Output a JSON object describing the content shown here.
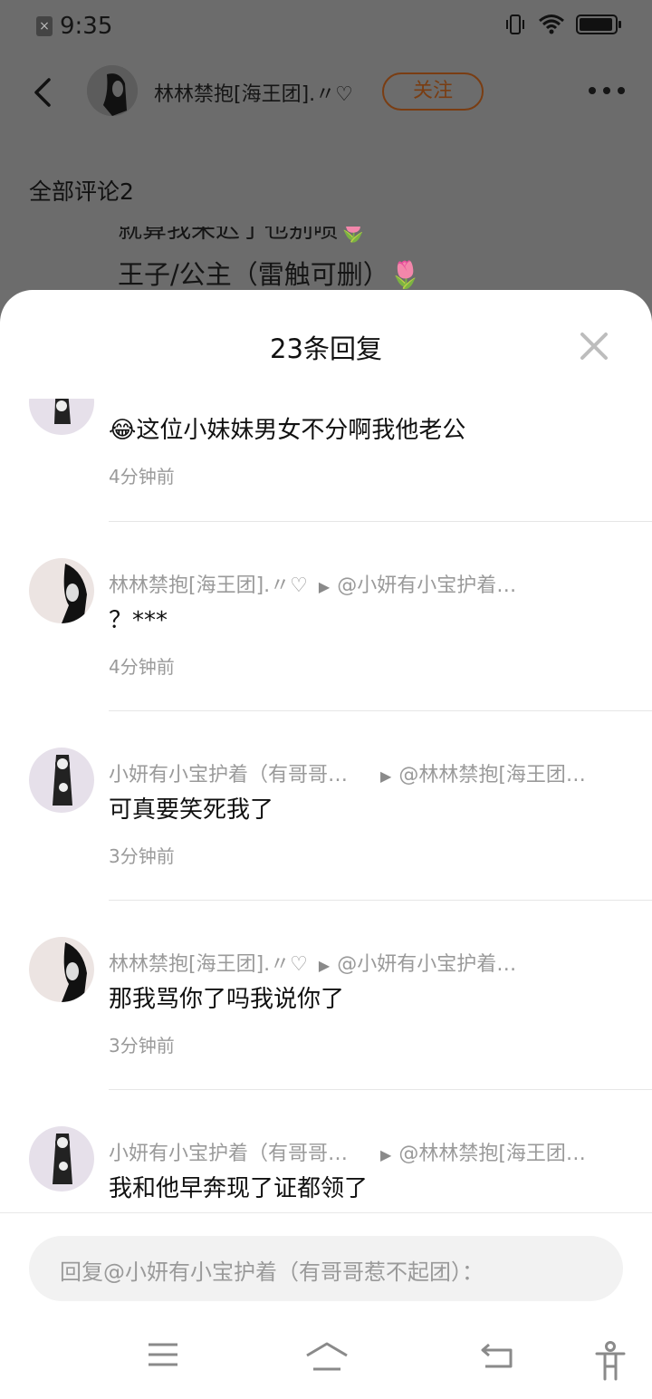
{
  "status_bar": {
    "time": "9:35",
    "notification_icon": "close-box-icon",
    "icons": [
      "vibrate-icon",
      "wifi-icon",
      "battery-icon"
    ]
  },
  "header": {
    "username": "林林禁抱[海王团].〃♡",
    "follow_label": "关注",
    "more_icon": "more-dots-icon",
    "back_icon": "back-arrow-icon"
  },
  "background": {
    "comments_title": "全部评论2",
    "peek_line_1": "就算我来迟了也别喷🌷",
    "peek_line_2": "王子/公主（雷触可删）🌷"
  },
  "sheet": {
    "title": "23条回复",
    "close_icon": "close-x-icon",
    "replies": [
      {
        "author": "",
        "target": "",
        "text": "😂这位小妹妹男女不分啊我他老公",
        "time": "4分钟前"
      },
      {
        "author": "林林禁抱[海王团].〃♡",
        "target": "@小妍有小宝护着…",
        "text": "？***",
        "time": "4分钟前"
      },
      {
        "author": "小妍有小宝护着（有哥哥…",
        "target": "@林林禁抱[海王团…",
        "text": "可真要笑死我了",
        "time": "3分钟前"
      },
      {
        "author": "林林禁抱[海王团].〃♡",
        "target": "@小妍有小宝护着…",
        "text": "那我骂你了吗我说你了",
        "time": "3分钟前"
      },
      {
        "author": "小妍有小宝护着（有哥哥…",
        "target": "@林林禁抱[海王团…",
        "text": "我和他早奔现了证都领了",
        "time": ""
      }
    ],
    "reply_placeholder": "回复@小妍有小宝护着（有哥哥惹不起团）："
  },
  "nav_bar": {
    "icons": [
      "menu-icon",
      "home-icon",
      "back-icon",
      "accessibility-icon"
    ]
  },
  "colors": {
    "follow_accent": "#7a3d12",
    "overlay": "#6c6c6c",
    "sheet_bg": "#ffffff",
    "meta_gray": "#9a9a9a"
  }
}
